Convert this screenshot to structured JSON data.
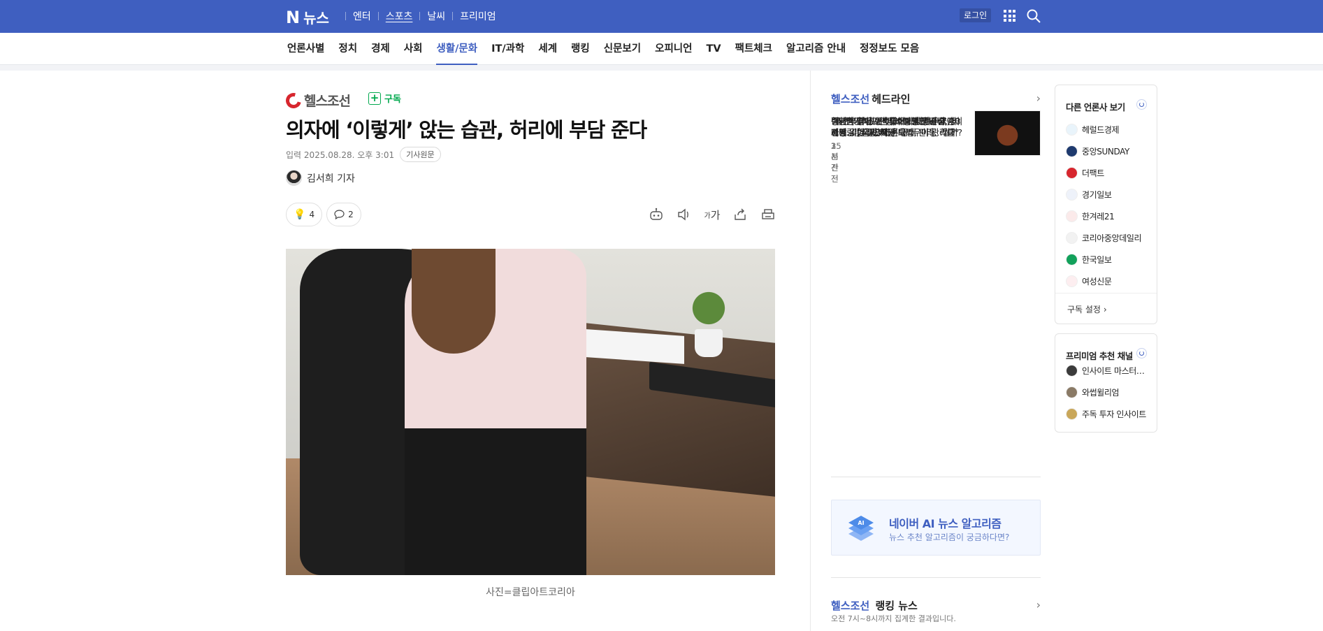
{
  "topbar": {
    "logo_n": "N",
    "logo_text": "뉴스",
    "services": [
      {
        "label": "엔터",
        "underline": false
      },
      {
        "label": "스포츠",
        "underline": true
      },
      {
        "label": "날씨",
        "underline": false
      },
      {
        "label": "프리미엄",
        "underline": false
      }
    ],
    "login_label": "로그인",
    "grid_icon": "apps-grid-icon",
    "search_icon": "search-icon",
    "bg_color": "#3f5fc0"
  },
  "nav": {
    "items": [
      "언론사별",
      "정치",
      "경제",
      "사회",
      "생활/문화",
      "IT/과학",
      "세계",
      "랭킹",
      "신문보기",
      "오피니언",
      "TV",
      "팩트체크",
      "알고리즘 안내",
      "정정보도 모음"
    ],
    "active_index": 4
  },
  "article": {
    "press_name": "헬스조선",
    "subscribe_label": "구독",
    "headline": "의자에 ‘이렇게’ 앉는 습관, 허리에 부담 준다",
    "date_label": "입력",
    "date": "2025.08.28. 오후 3:01",
    "original_label": "기사원문",
    "reporter": "김서희 기자",
    "reactions": {
      "like_count": "4",
      "comment_count": "2"
    },
    "tools": {
      "summary_label": "요약",
      "font_label": "가"
    },
    "caption": "사진=클립아트코리아"
  },
  "headline_panel": {
    "brand": "헬스조선",
    "title": "헤드라인",
    "items": [
      {
        "text": "“말 안 들어 고속도로에 내려두고 떠나”… 汝 극단적 훈육법, ‘아동 학대’ …",
        "time": "1시간전"
      },
      {
        "text": "중년이 겪던 ‘인생의 불행한 고비’, 이제는 ‘이 나이’에 온다",
        "time": "1시간전"
      },
      {
        "text": "“살 적당히 찌면 좋아” 노인 수술 후 사망 위험 줄였다",
        "time": "2시간전"
      },
      {
        "text": "“라면 기억도 안 나” 모델 김진경, 13년째 ‘이 습관’ 지켜 몸매 관리…뭘까?",
        "time": "3시간전"
      },
      {
        "text": "혈당 부담 없는 ‘바나나 땅콩버터 아이스크림’[밀당365]",
        "time": "25분전"
      },
      {
        "text": "이태원 참사 이후, 소방관 잇단 극단 선택… “국가 차원 트라우마 관리를”",
        "time": "35분전"
      }
    ]
  },
  "ai_banner": {
    "title": "네이버 AI 뉴스 알고리즘",
    "subtitle": "뉴스 추천 알고리즘이 궁금하다면?"
  },
  "ranking": {
    "brand": "헬스조선",
    "title": "랭킹 뉴스",
    "subtitle": "오전 7시~8시까지 집계한 결과입니다."
  },
  "other_press": {
    "title": "다른 언론사 보기",
    "items": [
      {
        "name": "헤럴드경제",
        "color": "#e9f4fb"
      },
      {
        "name": "중앙SUNDAY",
        "color": "#1e3a6e"
      },
      {
        "name": "더팩트",
        "color": "#d7262e"
      },
      {
        "name": "경기일보",
        "color": "#eef2fa"
      },
      {
        "name": "한겨레21",
        "color": "#fbeaea"
      },
      {
        "name": "코리아중앙데일리",
        "color": "#f2f2f2"
      },
      {
        "name": "한국일보",
        "color": "#12a15b"
      },
      {
        "name": "여성신문",
        "color": "#fdeef0"
      }
    ],
    "setting_label": "구독 설정"
  },
  "premium": {
    "title": "프리미엄 추천 채널",
    "items": [
      {
        "name": "인사이트 마스터…",
        "color": "#3b3b3b"
      },
      {
        "name": "와썹윌리엄",
        "color": "#8a7a66"
      },
      {
        "name": "주독 투자 인사이트",
        "color": "#c9a75a"
      }
    ]
  }
}
